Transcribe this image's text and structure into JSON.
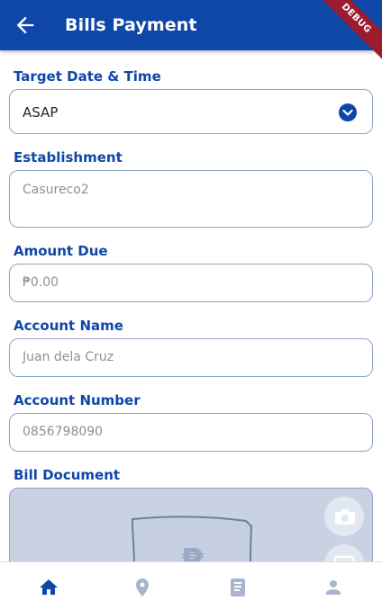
{
  "appbar": {
    "title": "Bills Payment",
    "debug": "DEBUG"
  },
  "form": {
    "target_date": {
      "label": "Target Date & Time",
      "value": "ASAP"
    },
    "establishment": {
      "label": "Establishment",
      "placeholder": "Casureco2"
    },
    "amount_due": {
      "label": "Amount Due",
      "placeholder": "₱0.00"
    },
    "account_name": {
      "label": "Account Name",
      "placeholder": "Juan dela Cruz"
    },
    "account_number": {
      "label": "Account Number",
      "placeholder": "0856798090"
    },
    "bill_document": {
      "label": "Bill Document"
    }
  },
  "bottom_nav": {
    "items": [
      {
        "icon": "home-icon",
        "active": true
      },
      {
        "icon": "location-icon",
        "active": false
      },
      {
        "icon": "book-icon",
        "active": false
      },
      {
        "icon": "person-icon",
        "active": false
      }
    ]
  },
  "colors": {
    "primary": "#0f47a8",
    "inactive": "#aab4cf",
    "border": "#8fa3c4",
    "debug": "#9b1c2e"
  }
}
